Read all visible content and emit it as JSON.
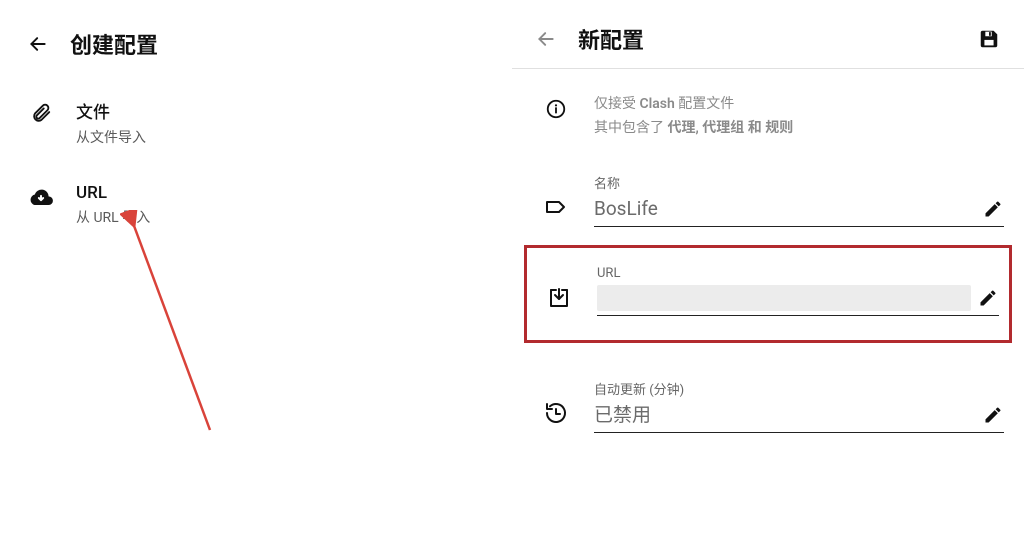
{
  "left": {
    "title": "创建配置",
    "items": [
      {
        "title": "文件",
        "sub": "从文件导入"
      },
      {
        "title": "URL",
        "sub": "从 URL 导入"
      }
    ]
  },
  "right": {
    "title": "新配置",
    "info": {
      "line1_prefix": "仅接受 ",
      "line1_bold": "Clash",
      "line1_suffix": " 配置文件",
      "line2_prefix": "其中包含了 ",
      "line2_bold": "代理, 代理组 和 规则"
    },
    "name": {
      "label": "名称",
      "value": "BosLife"
    },
    "url": {
      "label": "URL",
      "value": ""
    },
    "auto": {
      "label": "自动更新 (分钟)",
      "value": "已禁用"
    }
  }
}
